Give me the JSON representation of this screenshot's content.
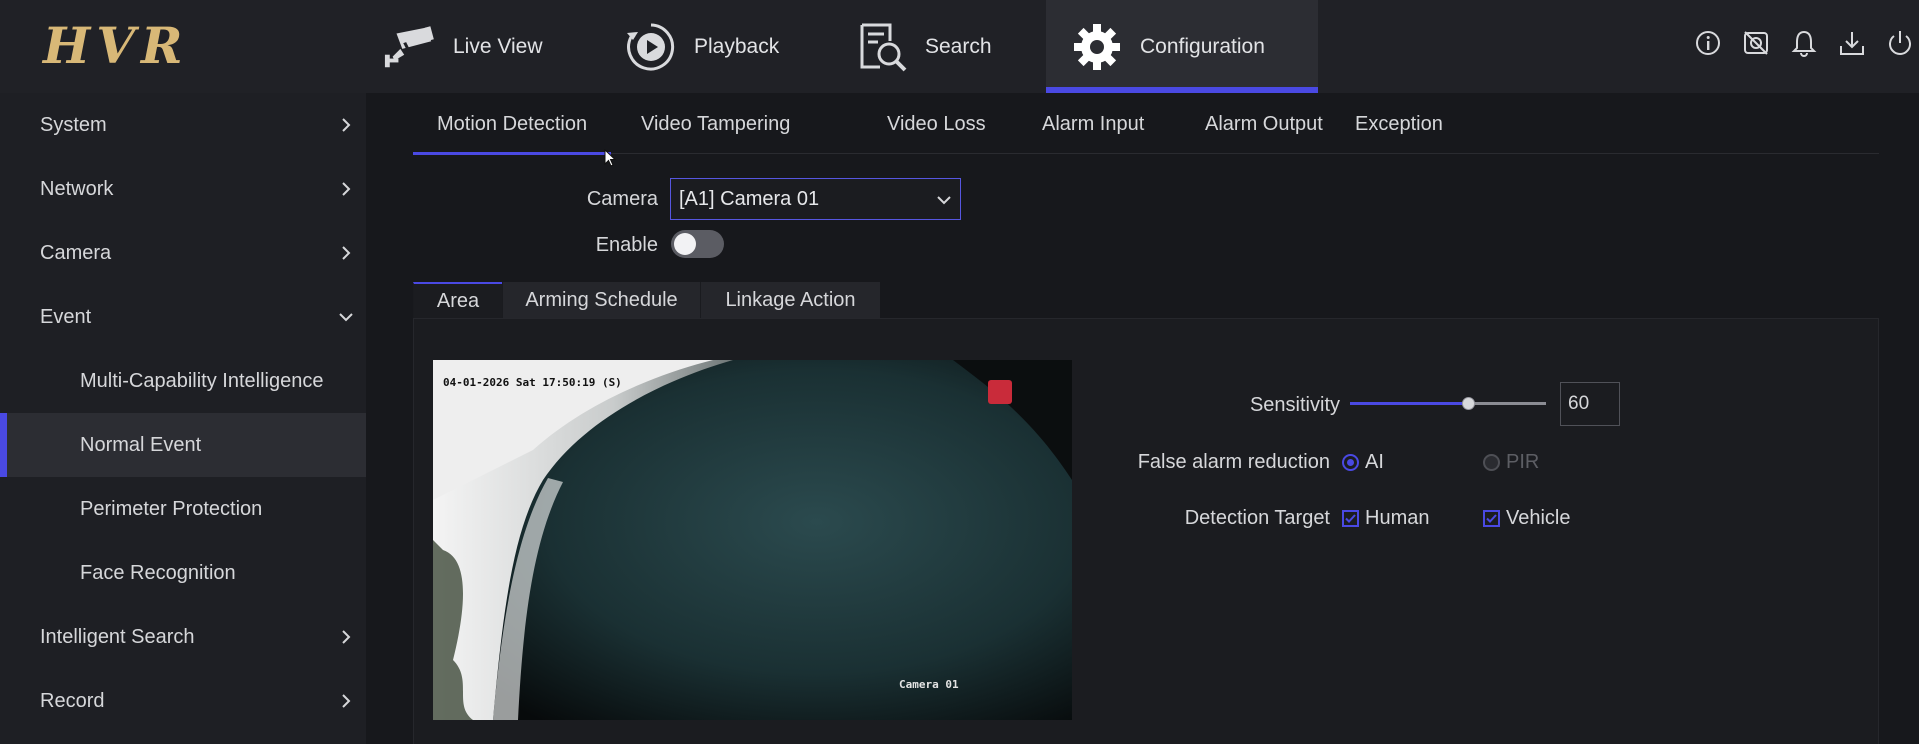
{
  "app": {
    "logo_text": "HVR"
  },
  "topnav": {
    "tabs": [
      {
        "label": "Live View",
        "icon": "cctv-camera-icon"
      },
      {
        "label": "Playback",
        "icon": "playback-icon"
      },
      {
        "label": "Search",
        "icon": "search-document-icon"
      },
      {
        "label": "Configuration",
        "icon": "gear-icon",
        "active": true
      }
    ],
    "right_icons": [
      "info-icon",
      "camera-off-icon",
      "bell-icon",
      "download-icon",
      "power-icon"
    ]
  },
  "sidebar": {
    "items": [
      {
        "label": "System",
        "level": 0,
        "chevron": "right"
      },
      {
        "label": "Network",
        "level": 0,
        "chevron": "right"
      },
      {
        "label": "Camera",
        "level": 0,
        "chevron": "right"
      },
      {
        "label": "Event",
        "level": 0,
        "chevron": "down"
      },
      {
        "label": "Multi-Capability Intelligence",
        "level": 1
      },
      {
        "label": "Normal Event",
        "level": 1,
        "active": true
      },
      {
        "label": "Perimeter Protection",
        "level": 1
      },
      {
        "label": "Face Recognition",
        "level": 1
      },
      {
        "label": "Intelligent Search",
        "level": 0,
        "chevron": "right"
      },
      {
        "label": "Record",
        "level": 0,
        "chevron": "right"
      }
    ]
  },
  "subtabs": [
    {
      "label": "Motion Detection",
      "active": true
    },
    {
      "label": "Video Tampering"
    },
    {
      "label": "Video Loss"
    },
    {
      "label": "Alarm Input"
    },
    {
      "label": "Alarm Output"
    },
    {
      "label": "Exception"
    }
  ],
  "form": {
    "camera_label": "Camera",
    "camera_value": "[A1] Camera 01",
    "enable_label": "Enable",
    "enable_on": false
  },
  "area_tabs": [
    {
      "label": "Area",
      "active": true
    },
    {
      "label": "Arming Schedule"
    },
    {
      "label": "Linkage Action"
    }
  ],
  "preview": {
    "osd_time": "04-01-2026 Sat 17:50:19 (S)",
    "osd_name": "Camera 01"
  },
  "settings": {
    "sensitivity_label": "Sensitivity",
    "sensitivity_value": "60",
    "sensitivity_fraction": 0.6,
    "false_alarm_label": "False alarm reduction",
    "false_alarm_options": [
      {
        "label": "AI",
        "selected": true,
        "disabled": false
      },
      {
        "label": "PIR",
        "selected": false,
        "disabled": true
      }
    ],
    "detection_target_label": "Detection Target",
    "detection_targets": [
      {
        "label": "Human",
        "checked": true
      },
      {
        "label": "Vehicle",
        "checked": true
      }
    ]
  },
  "colors": {
    "accent": "#4a49e3",
    "logo": "#d8b877",
    "background": "#17181c"
  }
}
